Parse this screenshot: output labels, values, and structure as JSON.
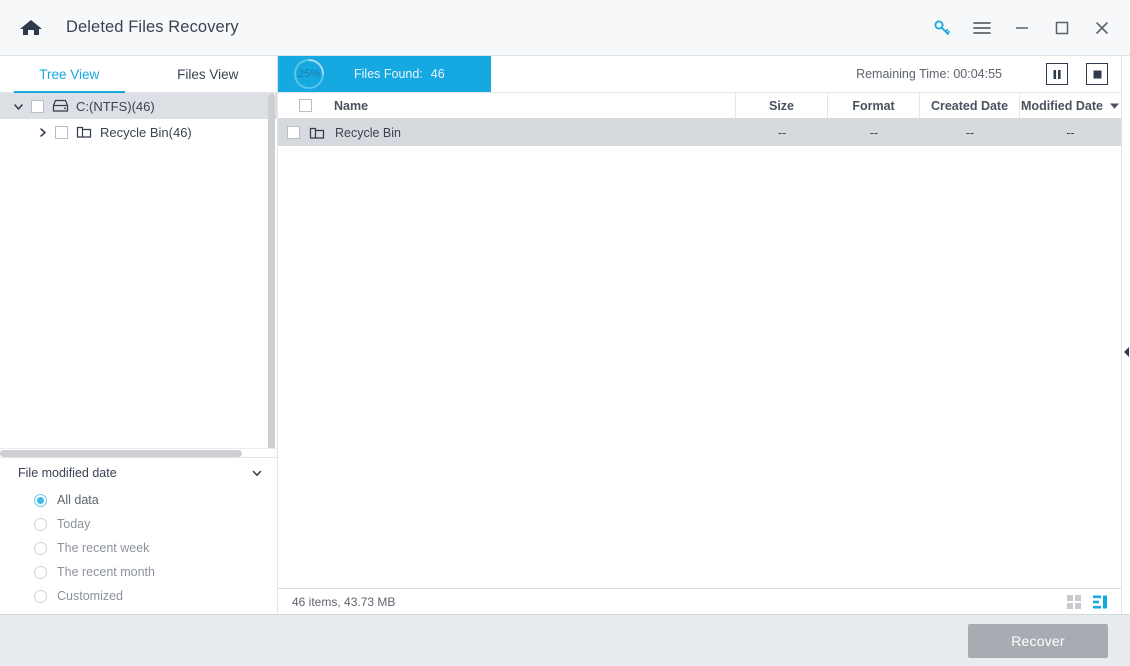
{
  "window": {
    "title": "Deleted Files Recovery",
    "home_icon": "home-icon",
    "key_icon": "key-icon",
    "menu_icon": "hamburger-menu-icon",
    "minimize_icon": "minimize-icon",
    "maximize_icon": "maximize-icon",
    "close_icon": "close-icon",
    "accent_color": "#16a8e0",
    "title_color": "#3a4353"
  },
  "sidebar": {
    "tabs": [
      {
        "label": "Tree View",
        "active": true
      },
      {
        "label": "Files View",
        "active": false
      }
    ],
    "tree": [
      {
        "label": "C:(NTFS)(46)",
        "icon": "drive-icon",
        "expanded": true,
        "level": 0,
        "selected": true
      },
      {
        "label": "Recycle Bin(46)",
        "icon": "folder-icon",
        "expanded": false,
        "level": 1,
        "selected": false
      }
    ],
    "filter": {
      "title": "File modified date",
      "chevron_icon": "chevron-down-icon",
      "options": [
        {
          "label": "All data",
          "checked": true
        },
        {
          "label": "Today",
          "checked": false
        },
        {
          "label": "The recent week",
          "checked": false
        },
        {
          "label": "The recent month",
          "checked": false
        },
        {
          "label": "Customized",
          "checked": false
        }
      ]
    }
  },
  "scan": {
    "percent_label": "25%",
    "percent_value": 25,
    "files_found_label": "Files Found:",
    "files_found_count": "46",
    "remaining_label": "Remaining Time: 00:04:55",
    "pause_icon": "pause-icon",
    "stop_icon": "stop-icon",
    "bar_color": "#16a8e0"
  },
  "table": {
    "columns": [
      "Name",
      "Size",
      "Format",
      "Created Date",
      "Modified Date"
    ],
    "sorted_column": "Modified Date",
    "sort_icon": "sort-descending-arrow-icon",
    "rows": [
      {
        "name": "Recycle Bin",
        "icon": "folder-icon",
        "size": "--",
        "format": "--",
        "created": "--",
        "modified": "--",
        "selected": true
      }
    ]
  },
  "status": {
    "summary": "46 items, 43.73 MB",
    "grid_view_icon": "grid-view-icon",
    "list_view_icon": "list-view-icon",
    "active_view": "list"
  },
  "edge": {
    "collapse_icon": "collapse-left-arrow-icon"
  },
  "footer": {
    "recover_label": "Recover",
    "recover_enabled": false
  }
}
